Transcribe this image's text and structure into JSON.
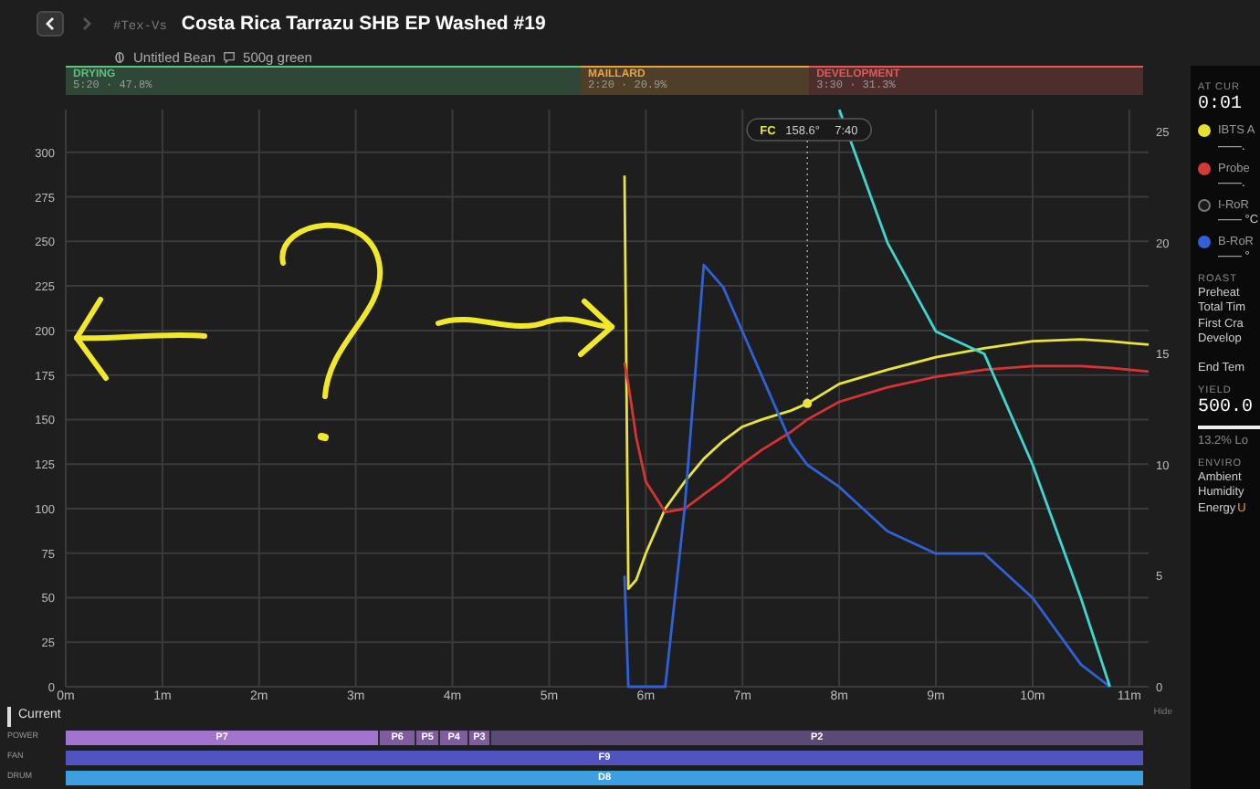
{
  "nav": {
    "back": {
      "disabled": false
    },
    "forward": {
      "disabled": true
    }
  },
  "header": {
    "breadcrumb": "#Tex-Vs",
    "title": "Costa Rica Tarrazu SHB EP Washed #19",
    "bean": "Untitled Bean",
    "weight": "500g green"
  },
  "phases": [
    {
      "label": "DRYING",
      "stats": "5:20 · 47.8%",
      "color": "#5fc27e"
    },
    {
      "label": "MAILLARD",
      "stats": "2:20 · 20.9%",
      "color": "#e3a447"
    },
    {
      "label": "DEVELOPMENT",
      "stats": "3:30 · 31.3%",
      "color": "#e05a5a"
    }
  ],
  "chart": {
    "event_tooltip": {
      "temp": "158.6°",
      "time": "7:40"
    },
    "chart_data": {
      "type": "line",
      "grid": true,
      "x": [
        5.78,
        5.82,
        5.9,
        6.0,
        6.2,
        6.4,
        6.6,
        6.8,
        7.0,
        7.2,
        7.5,
        7.67,
        8.0,
        8.5,
        9.0,
        9.5,
        10.0,
        10.5,
        10.8,
        11.0,
        11.2
      ],
      "series": [
        {
          "color": "#e8e43a",
          "values": [
            287,
            55,
            60,
            75,
            100,
            115,
            128,
            138,
            146,
            150,
            155,
            159,
            170,
            178,
            185,
            190,
            194,
            195,
            194,
            193,
            192
          ]
        },
        {
          "color": "#d83333",
          "values": [
            182,
            170,
            140,
            115,
            98,
            100,
            108,
            116,
            125,
            133,
            143,
            150,
            160,
            168,
            174,
            178,
            180,
            180,
            179,
            178,
            177
          ]
        },
        {
          "color": "#2f62d8",
          "axis": "y2",
          "values": [
            5,
            0,
            0,
            0,
            0,
            8,
            19,
            18,
            16,
            14,
            11,
            10,
            9,
            7,
            6,
            6,
            4,
            1,
            0,
            null,
            null
          ]
        },
        {
          "color": "#3fd6d0",
          "axis": "y2",
          "values": [
            null,
            null,
            null,
            null,
            null,
            null,
            null,
            null,
            null,
            null,
            null,
            null,
            26,
            20,
            16,
            15,
            10,
            4,
            0,
            null,
            null
          ]
        },
        {
          "color": "#e8e43a",
          "marker": "circle",
          "values": [
            null,
            null,
            null,
            null,
            null,
            null,
            null,
            null,
            null,
            null,
            null,
            159,
            null,
            null,
            null,
            null,
            null,
            null,
            null,
            null,
            null
          ]
        }
      ],
      "xlim": [
        0,
        11.2
      ],
      "ylim": [
        0,
        324
      ],
      "y2lim": [
        0,
        26
      ],
      "xticks": [
        {
          "value": 0,
          "label": "0m"
        },
        {
          "value": 1,
          "label": "1m"
        },
        {
          "value": 2,
          "label": "2m"
        },
        {
          "value": 3,
          "label": "3m"
        },
        {
          "value": 4,
          "label": "4m"
        },
        {
          "value": 5,
          "label": "5m"
        },
        {
          "value": 6,
          "label": "6m"
        },
        {
          "value": 7,
          "label": "7m"
        },
        {
          "value": 8,
          "label": "8m"
        },
        {
          "value": 9,
          "label": "9m"
        },
        {
          "value": 10,
          "label": "10m"
        },
        {
          "value": 11,
          "label": "11m"
        }
      ],
      "yticks": [
        0,
        25,
        50,
        75,
        100,
        125,
        150,
        175,
        200,
        225,
        250,
        275,
        300
      ],
      "y2ticks": [
        0,
        5,
        10,
        15,
        20,
        25
      ],
      "annotations": [
        "FC"
      ]
    }
  },
  "timeline": {
    "label": "Current",
    "hide": "Hide",
    "rows": [
      {
        "label": "POWER",
        "segments": [
          {
            "label": "P7",
            "color": "#a274cf"
          },
          {
            "label": "P6",
            "color": "#7e5c9f"
          },
          {
            "label": "P5",
            "color": "#7e5c9f"
          },
          {
            "label": "P4",
            "color": "#7e5c9f"
          },
          {
            "label": "P3",
            "color": "#7e5c9f"
          },
          {
            "label": "P2",
            "color": "#5b4a78"
          }
        ]
      },
      {
        "label": "FAN",
        "segments": [
          {
            "label": "F9",
            "color": "#5154c0"
          }
        ]
      },
      {
        "label": "DRUM",
        "segments": [
          {
            "label": "D8",
            "color": "#3d9fe0"
          }
        ]
      }
    ]
  },
  "sidebar": {
    "heading": "AT CUR",
    "clock": "0:01",
    "channels": [
      {
        "name": "IBTS A",
        "reading": "——.",
        "color": "#e6e033"
      },
      {
        "name": "Probe",
        "reading": "——.",
        "color": "#d33a3a"
      },
      {
        "name": "I-RoR",
        "reading": "—— °C",
        "color": "#1a1a1a"
      },
      {
        "name": "B-RoR",
        "reading": "—— °",
        "color": "#2f62d8"
      }
    ],
    "roast": {
      "heading": "ROAST",
      "items": [
        "Preheat",
        "Total Tim",
        "First Cra",
        "Develop"
      ],
      "end": "End Tem"
    },
    "yield": {
      "heading": "YIELD",
      "value": "500.0",
      "loss": "13.2% Lo"
    },
    "environment": {
      "heading": "ENVIRO",
      "items": [
        {
          "label": "Ambient"
        },
        {
          "label": "Humidity"
        },
        {
          "label": "Energy",
          "value": "U"
        }
      ]
    }
  }
}
